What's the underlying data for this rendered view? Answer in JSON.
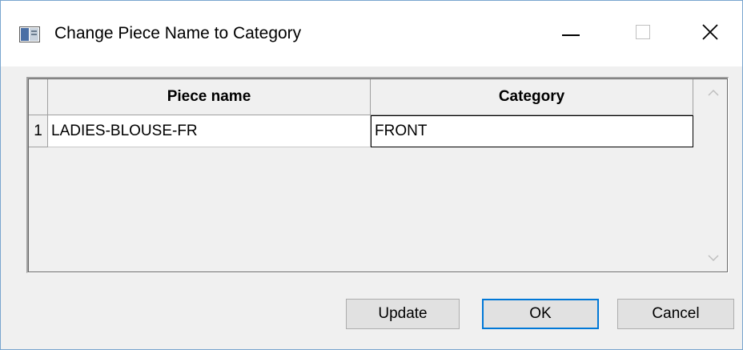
{
  "window": {
    "title": "Change Piece Name to Category",
    "app_icon": "dialog-app-icon",
    "controls": [
      "minimize-icon",
      "maximize-icon",
      "close-icon"
    ]
  },
  "grid": {
    "columns": [
      "Piece name",
      "Category"
    ],
    "rows": [
      {
        "number": "1",
        "piece_name": "LADIES-BLOUSE-FR",
        "category": "FRONT"
      }
    ],
    "scroll_icons": [
      "chevron-up-icon",
      "chevron-down-icon"
    ]
  },
  "buttons": {
    "update": "Update",
    "ok": "OK",
    "cancel": "Cancel"
  },
  "colors": {
    "window_border": "#7aa6cf",
    "dialog_bg": "#f0f0f0",
    "default_button_border": "#0078d7"
  }
}
